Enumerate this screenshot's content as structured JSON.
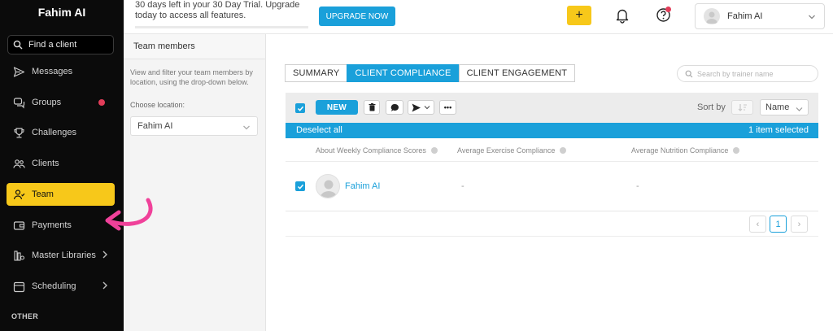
{
  "app": {
    "brand": "Fahim AI"
  },
  "sidebar": {
    "search_label": "Find a client",
    "items": [
      {
        "label": "Messages",
        "icon": "send-icon"
      },
      {
        "label": "Groups",
        "icon": "chat-bubbles-icon"
      },
      {
        "label": "Challenges",
        "icon": "trophy-icon"
      },
      {
        "label": "Clients",
        "icon": "people-icon"
      },
      {
        "label": "Team",
        "icon": "team-icon"
      },
      {
        "label": "Payments",
        "icon": "wallet-icon"
      },
      {
        "label": "Master Libraries",
        "icon": "library-icon"
      },
      {
        "label": "Scheduling",
        "icon": "calendar-icon"
      }
    ],
    "section_other": "OTHER"
  },
  "topbar": {
    "trial_text": "30 days left in your 30 Day Trial. Upgrade today to access all features.",
    "upgrade_label": "UPGRADE NOW",
    "plus_label": "+",
    "user_name": "Fahim AI"
  },
  "filter": {
    "title": "Team members",
    "description": "View and filter your team members by location, using the drop-down below.",
    "location_label": "Choose location:",
    "location_value": "Fahim AI"
  },
  "tabs": [
    "SUMMARY",
    "CLIENT COMPLIANCE",
    "CLIENT ENGAGEMENT"
  ],
  "search": {
    "placeholder": "Search by trainer name"
  },
  "toolbar": {
    "new_label": "NEW",
    "more_label": "•••",
    "sort_label": "Sort by",
    "sort_value": "Name"
  },
  "selection": {
    "deselect_label": "Deselect all",
    "count_label": "1 item selected"
  },
  "table": {
    "headers": [
      "About Weekly Compliance Scores",
      "Average Exercise Compliance",
      "Average Nutrition Compliance"
    ],
    "rows": [
      {
        "name": "Fahim AI",
        "exercise": "-",
        "nutrition": "-"
      }
    ]
  },
  "pagination": {
    "current": "1",
    "prev": "‹",
    "next": "›"
  },
  "colors": {
    "accent_blue": "#1aa0da",
    "accent_yellow": "#f7c81a",
    "sidebar_bg": "#0b0b0b",
    "alert_red": "#e23d59",
    "arrow_pink": "#f0419a"
  }
}
